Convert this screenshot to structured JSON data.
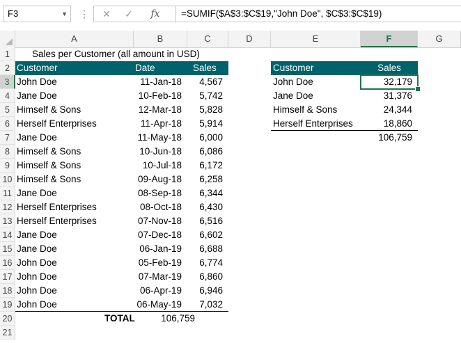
{
  "formula_bar": {
    "name_box": "F3",
    "name_box_arrow": "▼",
    "dots": "⋮",
    "cancel": "✕",
    "enter": "✓",
    "fx": "fx",
    "formula": "=SUMIF($A$3:$C$19,\"John Doe\", $C$3:$C$19)"
  },
  "columns": [
    "A",
    "B",
    "C",
    "D",
    "E",
    "F",
    "G"
  ],
  "rows": [
    "1",
    "2",
    "3",
    "4",
    "5",
    "6",
    "7",
    "8",
    "9",
    "10",
    "11",
    "12",
    "13",
    "14",
    "15",
    "16",
    "17",
    "18",
    "19",
    "20",
    "21"
  ],
  "title": "Sales per Customer (all amount in USD)",
  "main_table": {
    "headers": [
      "Customer",
      "Date",
      "Sales"
    ],
    "rows": [
      [
        "John Doe",
        "11-Jan-18",
        "4,567"
      ],
      [
        "Jane Doe",
        "10-Feb-18",
        "5,742"
      ],
      [
        "Himself & Sons",
        "12-Mar-18",
        "5,828"
      ],
      [
        "Herself Enterprises",
        "11-Apr-18",
        "5,914"
      ],
      [
        "Jane Doe",
        "11-May-18",
        "6,000"
      ],
      [
        "Himself & Sons",
        "10-Jun-18",
        "6,086"
      ],
      [
        "Himself & Sons",
        "10-Jul-18",
        "6,172"
      ],
      [
        "Himself & Sons",
        "09-Aug-18",
        "6,258"
      ],
      [
        "Jane Doe",
        "08-Sep-18",
        "6,344"
      ],
      [
        "Herself Enterprises",
        "08-Oct-18",
        "6,430"
      ],
      [
        "Herself Enterprises",
        "07-Nov-18",
        "6,516"
      ],
      [
        "Jane Doe",
        "07-Dec-18",
        "6,602"
      ],
      [
        "Jane Doe",
        "06-Jan-19",
        "6,688"
      ],
      [
        "John Doe",
        "05-Feb-19",
        "6,774"
      ],
      [
        "John Doe",
        "07-Mar-19",
        "6,860"
      ],
      [
        "John Doe",
        "06-Apr-19",
        "6,946"
      ],
      [
        "John Doe",
        "06-May-19",
        "7,032"
      ]
    ],
    "total_label": "TOTAL",
    "total_value": "106,759"
  },
  "summary_table": {
    "headers": [
      "Customer",
      "Sales"
    ],
    "rows": [
      [
        "John Doe",
        "32,179"
      ],
      [
        "Jane Doe",
        "31,376"
      ],
      [
        "Himself & Sons",
        "24,344"
      ],
      [
        "Herself Enterprises",
        "18,860"
      ]
    ],
    "total_value": "106,759"
  },
  "colors": {
    "header_fill": "#00626a",
    "selection": "#217346"
  },
  "active_cell": "F3"
}
